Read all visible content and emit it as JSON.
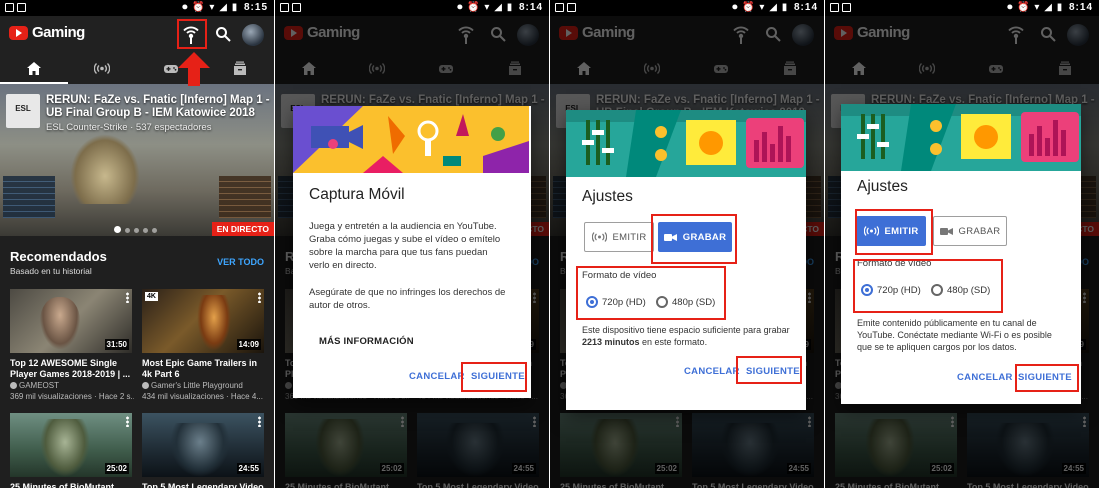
{
  "colors": {
    "brand_red": "#e62117",
    "accent_blue": "#3e6fd6",
    "link_blue": "#3ea6ff",
    "app_bg": "#1f1f1f",
    "highlight_box": "#e62117"
  },
  "panels": [
    {
      "status_time": "8:15",
      "app_title": "Gaming",
      "tabs": [
        {
          "icon": "home-icon",
          "active": true
        },
        {
          "icon": "live-icon",
          "active": false
        },
        {
          "icon": "gamepad-icon",
          "active": false
        },
        {
          "icon": "library-icon",
          "active": false
        }
      ],
      "hero": {
        "channel_logo": "ESL",
        "title": "RERUN: FaZe vs. Fnatic [Inferno] Map 1 - UB Final Group B - IEM Katowice 2018",
        "meta": "ESL Counter-Strike · 537 espectadores",
        "live_label": "EN DIRECTO"
      },
      "section": {
        "title": "Recomendados",
        "subtitle": "Basado en tu historial",
        "see_all": "VER TODO"
      },
      "videos": [
        {
          "title": "Top 12 AWESOME Single Player Games 2018-2019 | ...",
          "channel": "GAMEOST",
          "meta": "369 mil visualizaciones · Hace 2 s...",
          "duration": "31:50"
        },
        {
          "title": "Most Epic Game Trailers in 4k Part 6",
          "channel": "Gamer's Little Playground",
          "meta": "434 mil visualizaciones · Hace 4...",
          "duration": "14:09",
          "badge": "4K"
        },
        {
          "title": "25 Minutes of BioMutant",
          "channel": "",
          "meta": "",
          "duration": "25:02"
        },
        {
          "title": "Top 5 Most Legendary Video",
          "channel": "",
          "meta": "",
          "duration": "24:55"
        }
      ]
    },
    {
      "status_time": "8:14",
      "dialog": {
        "title": "Captura Móvil",
        "body1": "Juega y entretén a la audiencia en YouTube. Graba cómo juegas y sube el vídeo o emítelo sobre la marcha para que tus fans puedan verlo en directo.",
        "body2": "Asegúrate de que no infringes los derechos de autor de otros.",
        "more_info": "MÁS INFORMACIÓN",
        "cancel": "CANCELAR",
        "next": "SIGUIENTE"
      }
    },
    {
      "status_time": "8:14",
      "dialog": {
        "title": "Ajustes",
        "mode_broadcast": "EMITIR",
        "mode_record": "GRABAR",
        "selected_mode": "record",
        "format_label": "Formato de vídeo",
        "option_hd": "720p (HD)",
        "option_sd": "480p (SD)",
        "selected_format": "720p (HD)",
        "info_prefix": "Este dispositivo tiene espacio suficiente para grabar ",
        "info_minutes": "2213 minutos",
        "info_suffix": " en este formato.",
        "cancel": "CANCELAR",
        "next": "SIGUIENTE"
      }
    },
    {
      "status_time": "8:14",
      "dialog": {
        "title": "Ajustes",
        "mode_broadcast": "EMITIR",
        "mode_record": "GRABAR",
        "selected_mode": "broadcast",
        "format_label": "Formato de vídeo",
        "option_hd": "720p (HD)",
        "option_sd": "480p (SD)",
        "selected_format": "720p (HD)",
        "info": "Emite contenido públicamente en tu canal de YouTube. Conéctate mediante Wi-Fi o es posible que se te apliquen cargos por los datos.",
        "cancel": "CANCELAR",
        "next": "SIGUIENTE"
      }
    }
  ]
}
